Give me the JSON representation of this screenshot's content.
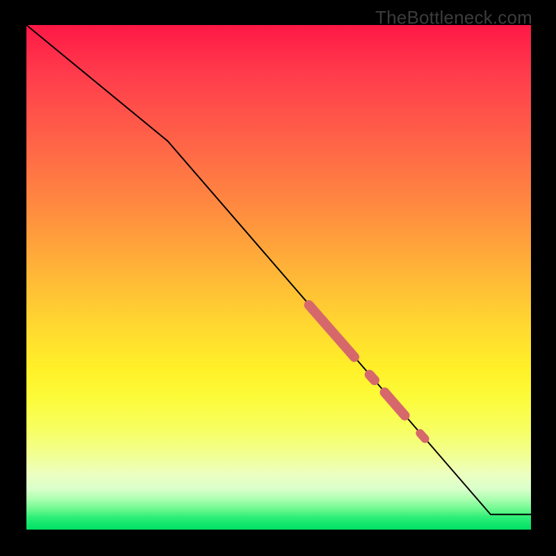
{
  "watermark": {
    "text": "TheBottleneck.com"
  },
  "colors": {
    "line": "#000000",
    "highlight": "#d6686b",
    "background_black": "#000000"
  },
  "chart_data": {
    "type": "line",
    "title": "",
    "xlabel": "",
    "ylabel": "",
    "xlim": [
      0,
      100
    ],
    "ylim": [
      0,
      100
    ],
    "grid": false,
    "legend": false,
    "line": {
      "x": [
        0,
        28,
        92,
        100
      ],
      "y": [
        100,
        77,
        3,
        3
      ]
    },
    "highlight_segments": [
      {
        "x": [
          56,
          65
        ],
        "y": [
          44.5,
          34.2
        ],
        "thick": true
      },
      {
        "x": [
          68,
          69
        ],
        "y": [
          30.7,
          29.6
        ],
        "thick": true
      },
      {
        "x": [
          71,
          75
        ],
        "y": [
          27.2,
          22.6
        ],
        "thick": true
      },
      {
        "x": [
          78,
          79
        ],
        "y": [
          19.1,
          18.0
        ],
        "thick": false
      }
    ],
    "gradient_note": "Vertical background gradient red→orange→yellow→green indicates score; green band near bottom."
  }
}
